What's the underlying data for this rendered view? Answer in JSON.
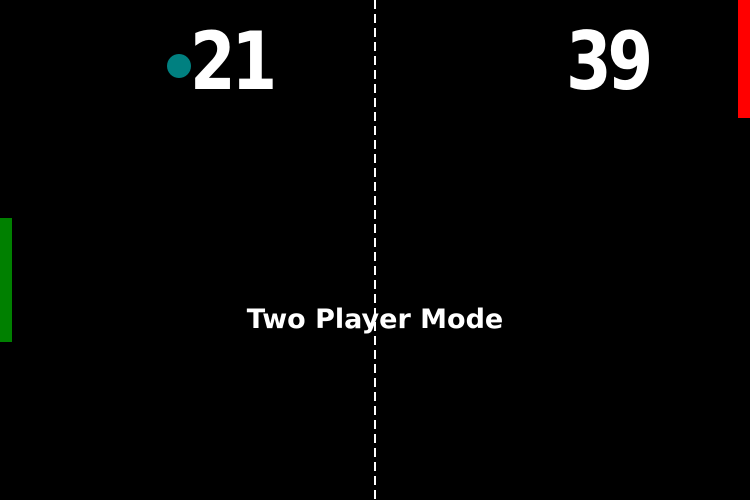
{
  "scoreboard": {
    "left_score": "21",
    "right_score": "39"
  },
  "mode_label": "Two Player Mode",
  "colors": {
    "background": "#000000",
    "left_paddle": "#008000",
    "right_paddle": "#ff0000",
    "ball": "#008080",
    "center_line": "#ffffff",
    "text": "#ffffff"
  }
}
